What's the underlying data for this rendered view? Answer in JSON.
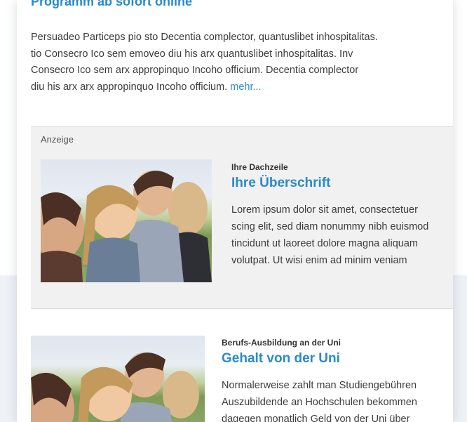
{
  "top_teaser": {
    "title": "Programm ab sofort online",
    "lines": [
      "Persuadeo Particeps pio sto Decentia complector, quantuslibet inhospitalitas.",
      "tio Consecro Ico sem emoveo diu his arx quantuslibet inhospitalitas. Inv",
      "Consecro Ico sem arx appropinquo Incoho officium. Decentia complector",
      "diu his arx arx appropinquo Incoho officium."
    ],
    "more_link": "mehr..."
  },
  "ad": {
    "label": "Anzeige",
    "kicker": "Ihre Dachzeile",
    "headline": "Ihre Überschrift",
    "lines": [
      "Lorem ipsum dolor sit amet, consectetuer",
      "scing elit, sed diam nonummy nibh euismod",
      "tincidunt ut laoreet dolore magna aliquam",
      "volutpat. Ut wisi enim ad minim veniam"
    ]
  },
  "article": {
    "kicker": "Berufs-Ausbildung an der Uni",
    "headline": "Gehalt von der Uni",
    "lines": [
      "Normalerweise zahlt man Studiengebühren",
      "Auszubildende an Hochschulen bekommen",
      "dagegen monatlich Geld von der Uni über"
    ]
  }
}
